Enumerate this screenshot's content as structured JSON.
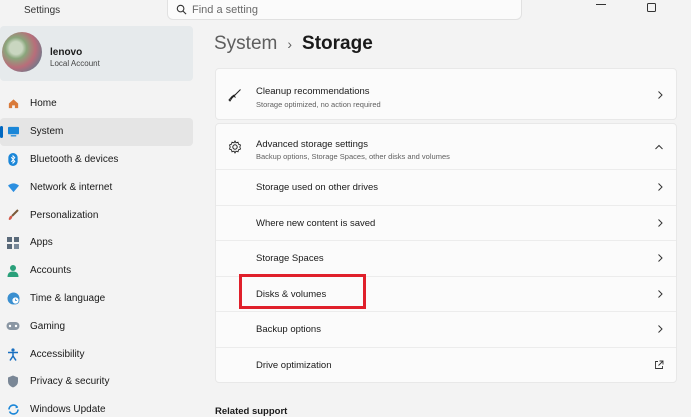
{
  "window": {
    "app_title": "Settings",
    "search_placeholder": "Find a setting"
  },
  "profile": {
    "name": "lenovo",
    "account_type": "Local Account"
  },
  "nav": [
    {
      "label": "Home",
      "icon": "home-icon"
    },
    {
      "label": "System",
      "icon": "system-icon",
      "active": true
    },
    {
      "label": "Bluetooth & devices",
      "icon": "bluetooth-icon"
    },
    {
      "label": "Network & internet",
      "icon": "wifi-icon"
    },
    {
      "label": "Personalization",
      "icon": "brush-icon"
    },
    {
      "label": "Apps",
      "icon": "apps-icon"
    },
    {
      "label": "Accounts",
      "icon": "accounts-icon"
    },
    {
      "label": "Time & language",
      "icon": "globe-clock-icon"
    },
    {
      "label": "Gaming",
      "icon": "gamepad-icon"
    },
    {
      "label": "Accessibility",
      "icon": "accessibility-icon"
    },
    {
      "label": "Privacy & security",
      "icon": "shield-icon"
    },
    {
      "label": "Windows Update",
      "icon": "update-icon"
    }
  ],
  "breadcrumb": {
    "parent": "System",
    "separator": "›",
    "current": "Storage"
  },
  "cleanup": {
    "title": "Cleanup recommendations",
    "subtitle": "Storage optimized, no action required"
  },
  "advanced": {
    "title": "Advanced storage settings",
    "subtitle": "Backup options, Storage Spaces, other disks and volumes",
    "expanded": true,
    "items": [
      {
        "label": "Storage used on other drives",
        "icon": "chevron-right-icon"
      },
      {
        "label": "Where new content is saved",
        "icon": "chevron-right-icon"
      },
      {
        "label": "Storage Spaces",
        "icon": "chevron-right-icon"
      },
      {
        "label": "Disks & volumes",
        "icon": "chevron-right-icon",
        "highlighted": true
      },
      {
        "label": "Backup options",
        "icon": "chevron-right-icon"
      },
      {
        "label": "Drive optimization",
        "icon": "external-link-icon"
      }
    ]
  },
  "related_support": {
    "heading": "Related support"
  },
  "colors": {
    "accent": "#0067c0",
    "highlight_box": "#e0202b"
  }
}
